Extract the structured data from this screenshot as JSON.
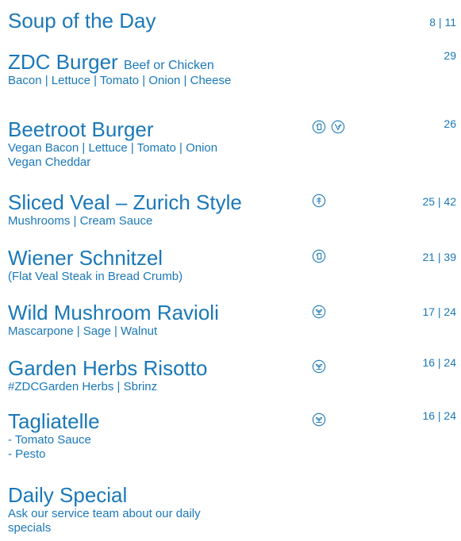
{
  "menu": {
    "items": [
      {
        "name": "Soup of the Day",
        "sub": "",
        "desc": "",
        "price": "8 | 11",
        "icons": []
      },
      {
        "name": "ZDC Burger",
        "sub": "Beef or Chicken",
        "desc": "Bacon | Lettuce | Tomato | Onion | Cheese",
        "price": "29",
        "icons": []
      },
      {
        "name": "Beetroot Burger",
        "sub": "",
        "desc": "Vegan Bacon | Lettuce | Tomato | Onion\nVegan Cheddar",
        "price": "26",
        "icons": [
          "dairy-free-icon",
          "vegan-icon"
        ]
      },
      {
        "name": "Sliced Veal – Zurich Style",
        "sub": "",
        "desc": "Mushrooms | Cream Sauce",
        "price": "25 | 42",
        "icons": [
          "gluten-free-icon"
        ]
      },
      {
        "name": "Wiener Schnitzel",
        "sub": "",
        "desc": "(Flat Veal Steak in Bread Crumb)",
        "price": "21 | 39",
        "icons": [
          "dairy-free-icon"
        ]
      },
      {
        "name": "Wild Mushroom Ravioli",
        "sub": "",
        "desc": "Mascarpone | Sage | Walnut",
        "price": "17 | 24",
        "icons": [
          "vegetarian-icon"
        ]
      },
      {
        "name": "Garden Herbs Risotto",
        "sub": "",
        "desc": "#ZDCGarden Herbs | Sbrinz",
        "price": "16 | 24",
        "icons": [
          "vegetarian-icon"
        ]
      },
      {
        "name": "Tagliatelle",
        "sub": "",
        "desc": "- Tomato Sauce\n- Pesto",
        "price": "16 | 24",
        "icons": [
          "vegetarian-icon"
        ]
      },
      {
        "name": "Daily Special",
        "sub": "",
        "desc": "Ask our service team about our daily\nspecials",
        "price": "",
        "icons": []
      }
    ]
  }
}
